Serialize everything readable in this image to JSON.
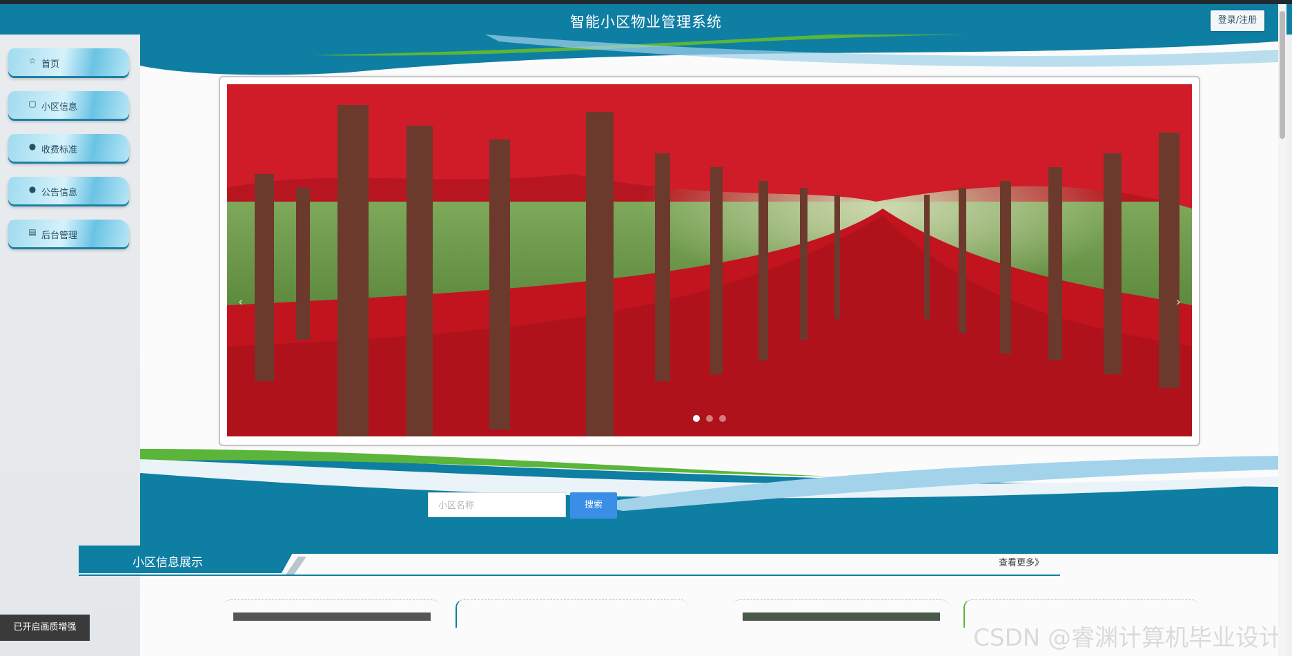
{
  "header": {
    "title": "智能小区物业管理系统",
    "login_label": "登录/注册"
  },
  "sidebar": {
    "items": [
      {
        "label": "首页",
        "icon": "star-icon"
      },
      {
        "label": "小区信息",
        "icon": "bag-icon"
      },
      {
        "label": "收费标准",
        "icon": "circle-info-icon"
      },
      {
        "label": "公告信息",
        "icon": "circle-info-icon"
      },
      {
        "label": "后台管理",
        "icon": "calendar-icon"
      }
    ]
  },
  "banner": {
    "slide_count": 3,
    "active_slide": 1
  },
  "search": {
    "placeholder": "小区名称",
    "button_label": "搜索"
  },
  "section": {
    "title": "小区信息展示",
    "more_label": "查看更多》"
  },
  "overlay": {
    "quality_label": "已开启画质增强",
    "watermark": "CSDN @睿渊计算机毕业设计"
  },
  "colors": {
    "primary": "#0f7ea3",
    "accent_green": "#5bb53a",
    "button_blue": "#3a8ee6"
  }
}
